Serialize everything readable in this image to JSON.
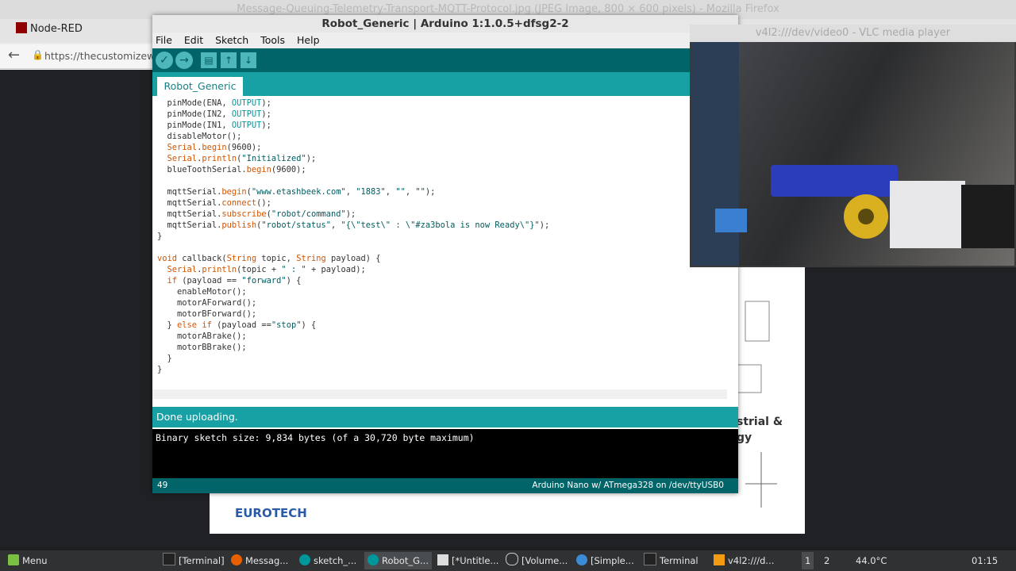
{
  "firefox": {
    "title": "Message-Queuing-Telemetry-Transport-MQTT-Protocol.jpg (JPEG Image, 800 × 600 pixels) - Mozilla Firefox",
    "tab": "Node-RED",
    "url": "https://thecustomizewin"
  },
  "slide": {
    "logo": "EUROTECH",
    "text_line1": "strial &",
    "text_line2": "gy"
  },
  "arduino": {
    "title": "Robot_Generic | Arduino 1:1.0.5+dfsg2-2",
    "menu": [
      "File",
      "Edit",
      "Sketch",
      "Tools",
      "Help"
    ],
    "toolbar": {
      "verify": "✓",
      "upload": "→",
      "new": "▤",
      "open": "↑",
      "save": "↓"
    },
    "tab": "Robot_Generic",
    "code": [
      "  pinMode(ENA, OUTPUT);",
      "  pinMode(IN2, OUTPUT);",
      "  pinMode(IN1, OUTPUT);",
      "  disableMotor();",
      "  Serial.begin(9600);",
      "  Serial.println(\"Initialized\");",
      "  blueToothSerial.begin(9600);",
      "",
      "  mqttSerial.begin(\"www.etashbeek.com\", \"1883\", \"\", \"\");",
      "  mqttSerial.connect();",
      "  mqttSerial.subscribe(\"robot/command\");",
      "  mqttSerial.publish(\"robot/status\", \"{\\\"test\\\" : \\\"#za3bola is now Ready\\\"}\");",
      "}",
      "",
      "void callback(String topic, String payload) {",
      "  Serial.println(topic + \" : \" + payload);",
      "  if (payload == \"forward\") {",
      "    enableMotor();",
      "    motorAForward();",
      "    motorBForward();",
      "  } else if (payload ==\"stop\") {",
      "    motorABrake();",
      "    motorBBrake();",
      "  }",
      "}"
    ],
    "status": "Done uploading.",
    "console": "Binary sketch size: 9,834 bytes (of a 30,720 byte maximum)",
    "line_number": "49",
    "board": "Arduino Nano w/ ATmega328 on /dev/ttyUSB0"
  },
  "vlc": {
    "title": "v4l2:///dev/video0 - VLC media player"
  },
  "taskbar": {
    "menu": "Menu",
    "items": [
      "[Terminal]",
      "Messag...",
      "sketch_...",
      "Robot_G...",
      "[*Untitle...",
      "[Volume...",
      "[Simple...",
      "Terminal",
      "v4l2:///d..."
    ],
    "workspaces": [
      "1",
      "2"
    ],
    "temperature": "44.0°C",
    "time": "01:15"
  },
  "colors": {
    "arduino_dark": "#006468",
    "arduino_teal": "#17a1a5"
  }
}
